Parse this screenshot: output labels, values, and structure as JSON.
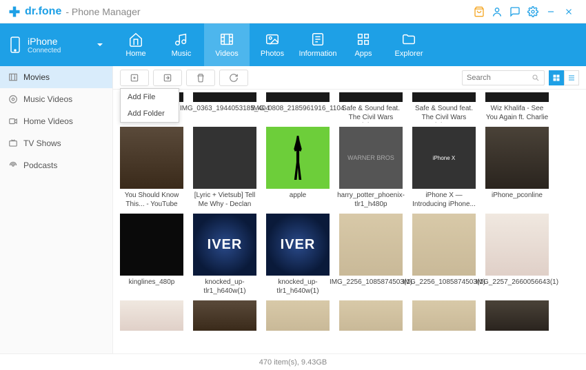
{
  "titlebar": {
    "brand_prefix": "dr.",
    "brand_main": "fone",
    "subtitle": "- Phone Manager"
  },
  "device": {
    "name": "iPhone",
    "status": "Connected"
  },
  "nav": [
    {
      "key": "home",
      "label": "Home"
    },
    {
      "key": "music",
      "label": "Music"
    },
    {
      "key": "videos",
      "label": "Videos"
    },
    {
      "key": "photos",
      "label": "Photos"
    },
    {
      "key": "information",
      "label": "Information"
    },
    {
      "key": "apps",
      "label": "Apps"
    },
    {
      "key": "explorer",
      "label": "Explorer"
    }
  ],
  "nav_active": "videos",
  "sidebar": [
    {
      "key": "movies",
      "label": "Movies"
    },
    {
      "key": "music-videos",
      "label": "Music Videos"
    },
    {
      "key": "home-videos",
      "label": "Home Videos"
    },
    {
      "key": "tv-shows",
      "label": "TV Shows"
    },
    {
      "key": "podcasts",
      "label": "Podcasts"
    }
  ],
  "sidebar_active": "movies",
  "dropdown": {
    "add_file": "Add File",
    "add_folder": "Add Folder"
  },
  "search": {
    "placeholder": "Search"
  },
  "grid": {
    "row0": [
      {
        "caption": ""
      },
      {
        "caption": "IMG_0363_1944053185_404"
      },
      {
        "caption": "IMG_0808_2185961916_1104"
      },
      {
        "caption": "Safe & Sound feat. The Civil Wars (The..."
      },
      {
        "caption": "Safe & Sound feat. The Civil Wars (The..."
      },
      {
        "caption": "Wiz Khalifa - See You Again ft. Charlie Pu..."
      }
    ],
    "row1": [
      {
        "caption": "You Should Know This... - YouTube",
        "variant": "face"
      },
      {
        "caption": "[Lyric + Vietsub] Tell Me Why - Declan G...",
        "variant": "text"
      },
      {
        "caption": "apple",
        "variant": "green"
      },
      {
        "caption": "harry_potter_phoenix-tlr1_h480p",
        "variant": "wb"
      },
      {
        "caption": "iPhone X — Introducing iPhone...",
        "variant": "text"
      },
      {
        "caption": "iPhone_pconline",
        "variant": "person"
      }
    ],
    "row2": [
      {
        "caption": "kinglines_480p",
        "variant": "bottle"
      },
      {
        "caption": "knocked_up-tlr1_h640w(1)",
        "variant": "globe"
      },
      {
        "caption": "knocked_up-tlr1_h640w(1)",
        "variant": "globe"
      },
      {
        "caption": "IMG_2256_1085874503(1)",
        "variant": "dance"
      },
      {
        "caption": "IMG_2256_1085874503(1)",
        "variant": "dance"
      },
      {
        "caption": "IMG_2257_2660056643(1)",
        "variant": "girl"
      }
    ]
  },
  "globe_text": "IVER",
  "wb_text": "WARNER BROS",
  "iphone_text": "iPhone X",
  "status": {
    "text": "470 item(s), 9.43GB"
  }
}
